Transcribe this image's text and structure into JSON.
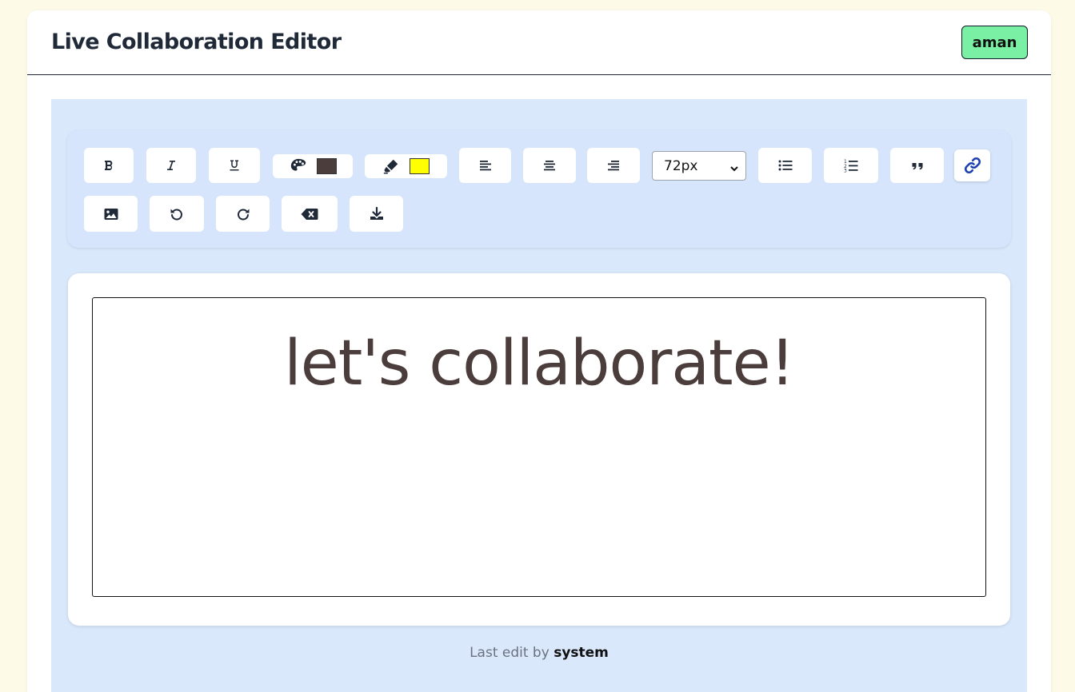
{
  "header": {
    "title": "Live Collaboration Editor",
    "user": "aman"
  },
  "toolbar": {
    "buttons": [
      {
        "name": "bold",
        "icon": "bold-icon"
      },
      {
        "name": "italic",
        "icon": "italic-icon"
      },
      {
        "name": "underline",
        "icon": "underline-icon"
      },
      {
        "name": "text-color",
        "icon": "palette-icon",
        "color": "#4c3d3d"
      },
      {
        "name": "highlight",
        "icon": "highlighter-icon",
        "color": "#ffff00"
      },
      {
        "name": "align-left",
        "icon": "align-left-icon"
      },
      {
        "name": "align-center",
        "icon": "align-center-icon"
      },
      {
        "name": "align-right",
        "icon": "align-right-icon"
      },
      {
        "name": "bullet-list",
        "icon": "list-ul-icon"
      },
      {
        "name": "ordered-list",
        "icon": "list-ol-icon"
      },
      {
        "name": "blockquote",
        "icon": "quote-icon"
      },
      {
        "name": "link",
        "icon": "link-icon"
      },
      {
        "name": "image",
        "icon": "image-icon"
      },
      {
        "name": "undo",
        "icon": "undo-icon"
      },
      {
        "name": "redo",
        "icon": "redo-icon"
      },
      {
        "name": "clear",
        "icon": "delete-left-icon"
      },
      {
        "name": "download",
        "icon": "download-icon"
      }
    ],
    "font_size": {
      "selected": "72px"
    }
  },
  "editor": {
    "content": "let's collaborate!"
  },
  "footer": {
    "prefix": "Last edit by",
    "user": "system"
  },
  "colors": {
    "page_bg": "#fefae8",
    "workspace_bg": "#dae8fc",
    "badge_bg": "#7af0a4",
    "text_color": "#4c3d3d",
    "highlight_color": "#ffff00",
    "link_icon": "#1e40af"
  }
}
